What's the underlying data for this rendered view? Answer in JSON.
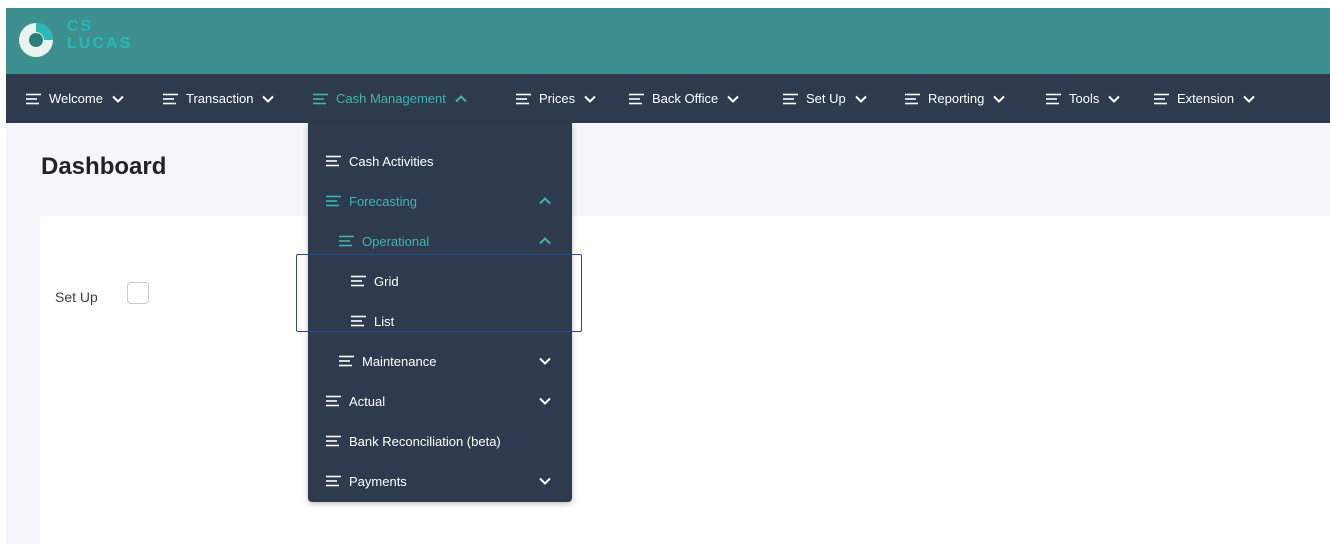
{
  "brand": {
    "line1": "CS",
    "line2": "LUCAS"
  },
  "menu": [
    {
      "label": "Welcome",
      "expanded": false
    },
    {
      "label": "Transaction",
      "expanded": false
    },
    {
      "label": "Cash Management",
      "expanded": true
    },
    {
      "label": "Prices",
      "expanded": false
    },
    {
      "label": "Back Office",
      "expanded": false
    },
    {
      "label": "Set Up",
      "expanded": false
    },
    {
      "label": "Reporting",
      "expanded": false
    },
    {
      "label": "Tools",
      "expanded": false
    },
    {
      "label": "Extension",
      "expanded": false
    }
  ],
  "page": {
    "title": "Dashboard"
  },
  "dashboard": {
    "setup_label": "Set Up",
    "setup_checked": false
  },
  "cash_menu": [
    {
      "label": "Cash Activities",
      "level": 0,
      "expandable": false
    },
    {
      "label": "Forecasting",
      "level": 0,
      "expandable": true,
      "expanded": true
    },
    {
      "label": "Operational",
      "level": 1,
      "expandable": true,
      "expanded": true
    },
    {
      "label": "Grid",
      "level": 2,
      "expandable": false
    },
    {
      "label": "List",
      "level": 2,
      "expandable": false
    },
    {
      "label": "Maintenance",
      "level": 1,
      "expandable": true,
      "expanded": false
    },
    {
      "label": "Actual",
      "level": 0,
      "expandable": true,
      "expanded": false
    },
    {
      "label": "Bank Reconciliation (beta)",
      "level": 0,
      "expandable": false
    },
    {
      "label": "Payments",
      "level": 0,
      "expandable": true,
      "expanded": false
    }
  ],
  "colors": {
    "header": "#3d8f90",
    "menubar": "#2e3b4e",
    "accent": "#3fb5ad",
    "highlight": "#2a4a8c"
  },
  "icons": {
    "menu_item": "lines-icon",
    "expand": "chevron-down-icon",
    "collapse": "chevron-up-icon"
  }
}
